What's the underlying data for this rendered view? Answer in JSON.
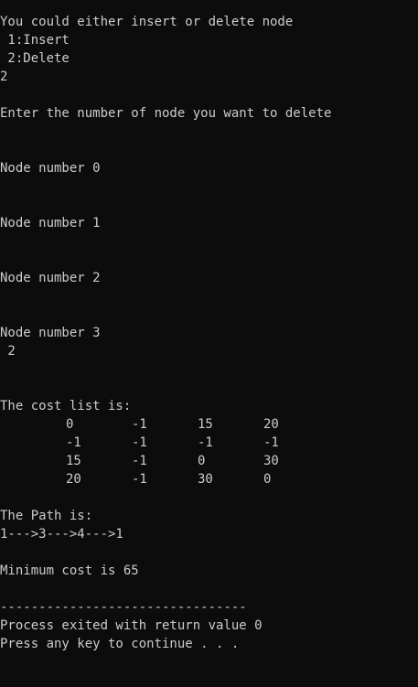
{
  "console": {
    "prompt_menu": "You could either insert or delete node",
    "option_insert": " 1:Insert",
    "option_delete": " 2:Delete",
    "user_choice": "2",
    "delete_prompt": "Enter the number of node you want to delete",
    "node_0": "Node number 0",
    "node_1": "Node number 1",
    "node_2": "Node number 2",
    "node_3": "Node number 3",
    "node_delete_input": " 2",
    "cost_list_heading": "The cost list is:",
    "cost_rows": [
      [
        "0",
        "-1",
        "15",
        "20"
      ],
      [
        "-1",
        "-1",
        "-1",
        "-1"
      ],
      [
        "15",
        "-1",
        "0",
        "30"
      ],
      [
        "20",
        "-1",
        "30",
        "0"
      ]
    ],
    "path_heading": "The Path is:",
    "path_value": "1--->3--->4--->1",
    "min_cost": "Minimum cost is 65",
    "separator": "--------------------------------",
    "exit_message": "Process exited with return value 0",
    "continue_message": "Press any key to continue . . ."
  },
  "colors": {
    "background": "#0c0c0c",
    "text": "#cccccc"
  }
}
